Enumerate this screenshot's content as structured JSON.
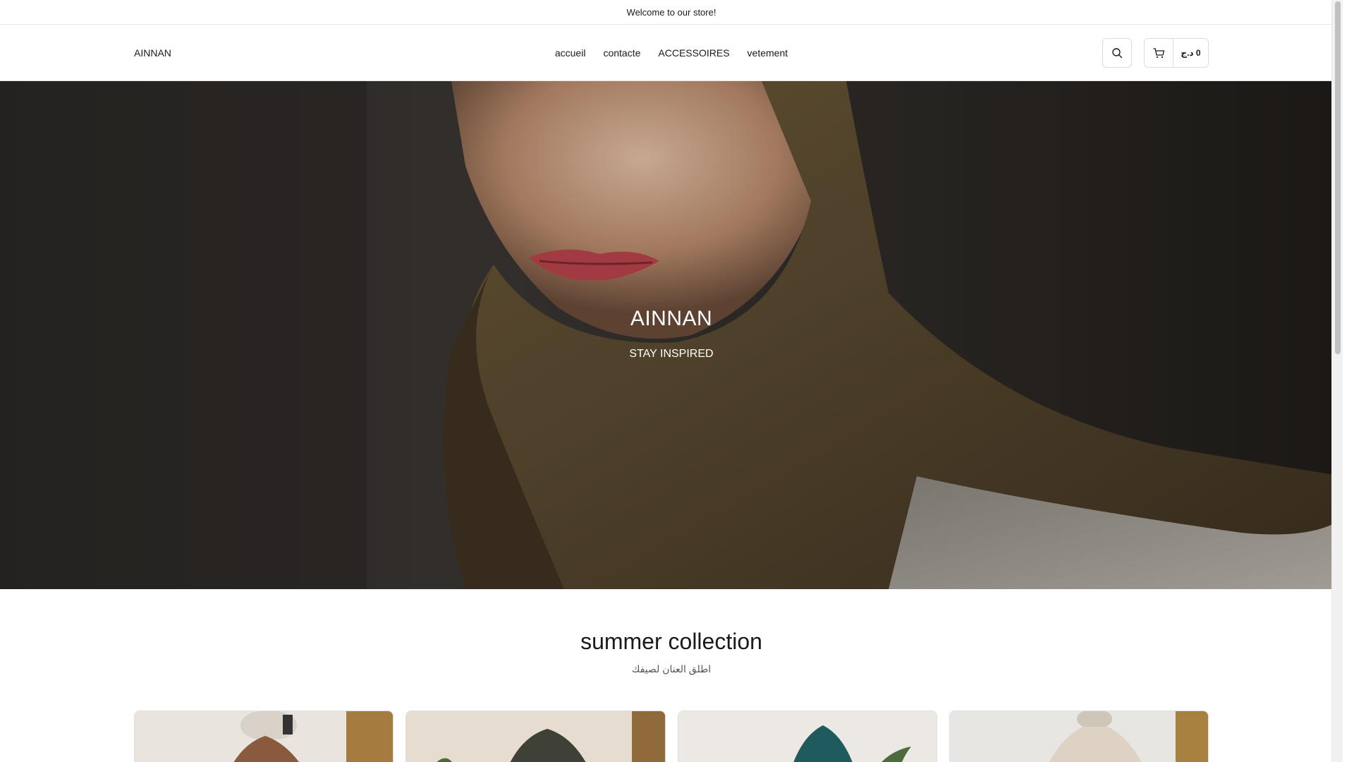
{
  "announcement": {
    "text": "Welcome to our store!"
  },
  "header": {
    "logo": "AINNAN",
    "nav": [
      {
        "label": "accueil"
      },
      {
        "label": "contacte"
      },
      {
        "label": "ACCESSOIRES"
      },
      {
        "label": "vetement"
      }
    ],
    "search_icon": "search-icon",
    "cart_icon": "cart-icon",
    "cart_total": "0 د.ج"
  },
  "hero": {
    "title": "AINNAN",
    "subtitle": "STAY INSPIRED"
  },
  "collection": {
    "title": "summer collection",
    "subtitle": "اطلق العنان لصيفك"
  },
  "products": [
    {
      "image": "product-image-brown-abaya"
    },
    {
      "image": "product-image-olive-abaya"
    },
    {
      "image": "product-image-teal-abaya"
    },
    {
      "image": "product-image-cream-abaya"
    }
  ],
  "colors": {
    "text": "#1a1a1a",
    "border": "#e6e6e6",
    "hijab": "#5a4a32",
    "background": "#ffffff"
  }
}
